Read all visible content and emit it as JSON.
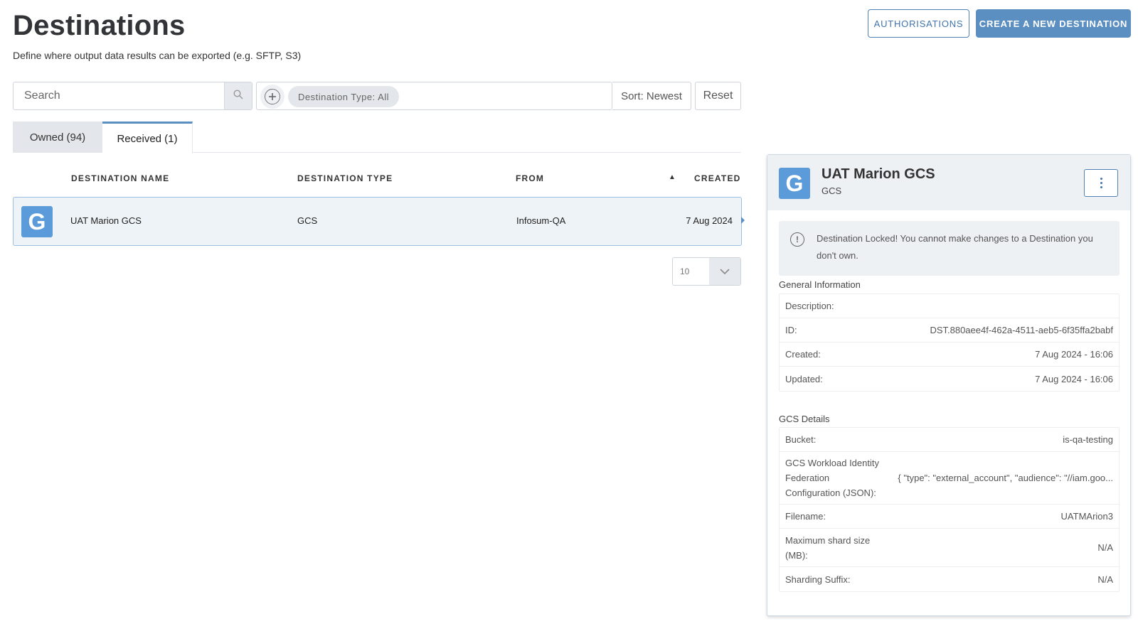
{
  "header": {
    "title": "Destinations",
    "subtitle": "Define where output data results can be exported (e.g. SFTP, S3)",
    "authorisations_label": "AUTHORISATIONS",
    "create_label": "CREATE A NEW DESTINATION"
  },
  "search": {
    "placeholder": "Search",
    "icon": "search-icon"
  },
  "filters": {
    "add_icon": "plus-circle-icon",
    "chip_label": "Destination Type: All",
    "sort_label": "Sort: Newest",
    "reset_label": "Reset"
  },
  "tabs": [
    {
      "label": "Owned (94)",
      "active": false
    },
    {
      "label": "Received (1)",
      "active": true
    }
  ],
  "table": {
    "columns": [
      "DESTINATION NAME",
      "DESTINATION TYPE",
      "FROM",
      "CREATED"
    ],
    "sort_indicator": "▲",
    "rows": [
      {
        "logo": "G",
        "name": "UAT Marion GCS",
        "type": "GCS",
        "from": "Infosum-QA",
        "created": "7 Aug 2024"
      }
    ]
  },
  "pagination": {
    "page_size": "10"
  },
  "panel": {
    "logo": "G",
    "title": "UAT Marion GCS",
    "subtitle": "GCS",
    "lock_message": "Destination Locked! You cannot make changes to a Destination you don't own.",
    "general_label": "General Information",
    "general": [
      {
        "key": "Description:",
        "value": ""
      },
      {
        "key": "ID:",
        "value": "DST.880aee4f-462a-4511-aeb5-6f35ffa2babf"
      },
      {
        "key": "Created:",
        "value": "7 Aug 2024 - 16:06"
      },
      {
        "key": "Updated:",
        "value": "7 Aug 2024 - 16:06"
      }
    ],
    "gcs_label": "GCS Details",
    "gcs": [
      {
        "key": "Bucket:",
        "value": "is-qa-testing"
      },
      {
        "key": "GCS Workload Identity Federation Configuration (JSON):",
        "value": "{ \"type\": \"external_account\", \"audience\": \"//iam.goo..."
      },
      {
        "key": "Filename:",
        "value": "UATMArion3"
      },
      {
        "key": "Maximum shard size (MB):",
        "value": "N/A"
      },
      {
        "key": "Sharding Suffix:",
        "value": "N/A"
      }
    ]
  },
  "colors": {
    "primary": "#5b8fc2",
    "logo_blue": "#5b9bd9",
    "selected_row": "#eef3f7"
  }
}
